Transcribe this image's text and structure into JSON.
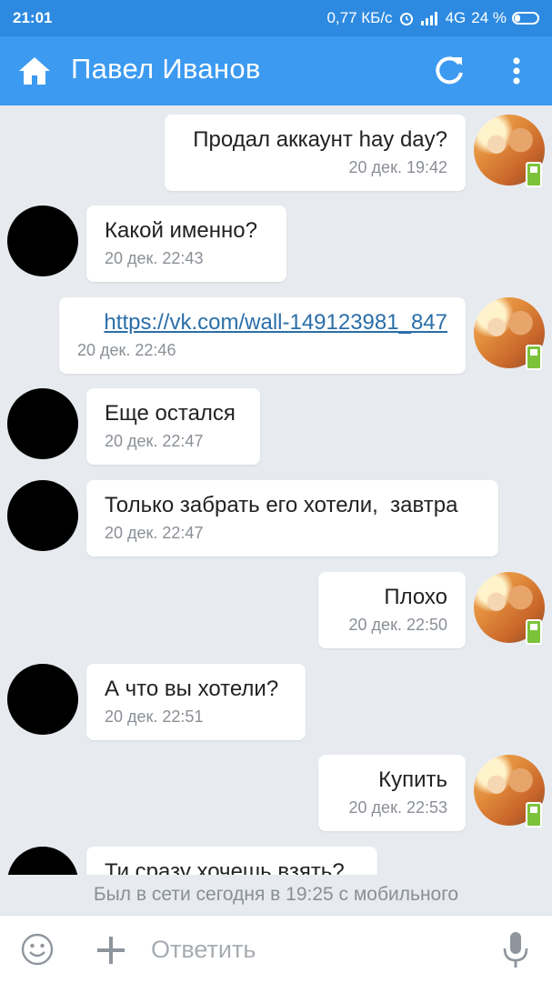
{
  "status_bar": {
    "time": "21:01",
    "network_speed": "0,77 КБ/с",
    "network_type": "4G",
    "battery_text": "24 %",
    "battery_level": 0.24
  },
  "header": {
    "title": "Павел Иванов",
    "home_icon": "home-icon",
    "refresh_icon": "refresh-icon",
    "menu_icon": "more-vert-icon",
    "color": "#3c9af0"
  },
  "messages": [
    {
      "direction": "out",
      "text": "Продал аккаунт hay day?",
      "date": "20 дек. 19:42"
    },
    {
      "direction": "in",
      "text": "Какой именно?",
      "date": "20 дек. 22:43"
    },
    {
      "direction": "out",
      "text": "https://vk.com/wall-149123981_847",
      "date": "20 дек. 22:46",
      "is_link": true
    },
    {
      "direction": "in",
      "text": "Еще остался",
      "date": "20 дек. 22:47"
    },
    {
      "direction": "in",
      "text": "Только забрать его хотели,  завтра",
      "date": "20 дек. 22:47"
    },
    {
      "direction": "out",
      "text": "Плохо",
      "date": "20 дек. 22:50"
    },
    {
      "direction": "in",
      "text": "А что вы хотели?",
      "date": "20 дек. 22:51"
    },
    {
      "direction": "out",
      "text": "Купить",
      "date": "20 дек. 22:53"
    },
    {
      "direction": "in",
      "text": "Ти сразу хочешь взять?",
      "date": ""
    }
  ],
  "last_seen": "Был в сети сегодня в 19:25 с мобильного",
  "input": {
    "placeholder": "Ответить",
    "emoji_icon": "emoji-icon",
    "attach_icon": "plus-icon",
    "mic_icon": "mic-icon"
  }
}
